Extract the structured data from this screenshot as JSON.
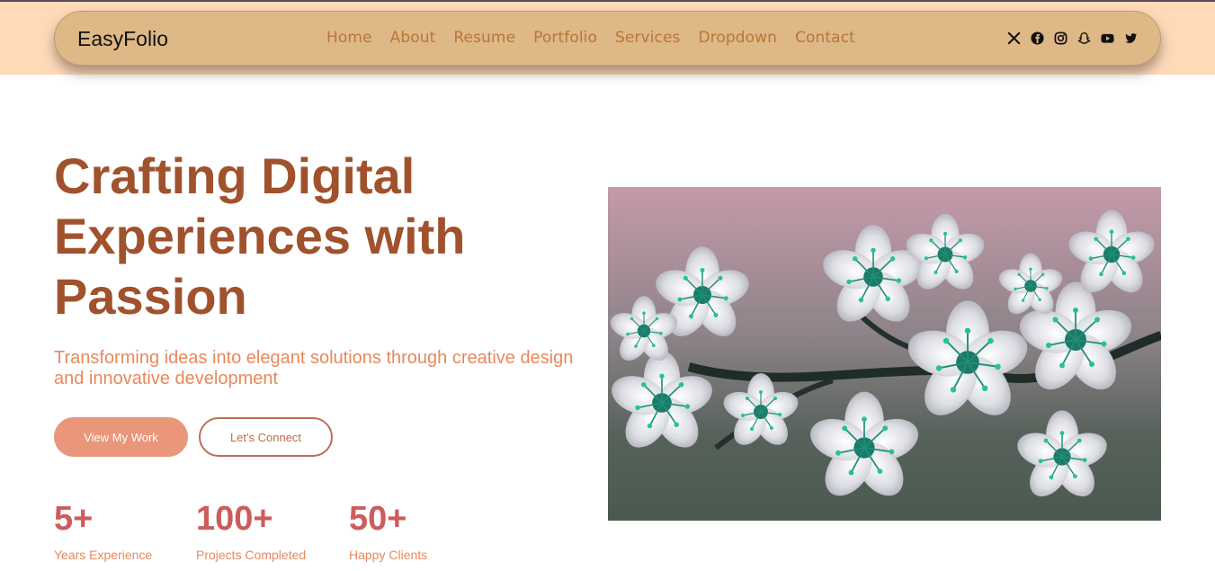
{
  "header": {
    "logo": "EasyFolio",
    "nav": [
      "Home",
      "About",
      "Resume",
      "Portfolio",
      "Services",
      "Dropdown",
      "Contact"
    ],
    "social_icons": [
      "x-icon",
      "facebook-icon",
      "instagram-icon",
      "snapchat-icon",
      "youtube-icon",
      "twitter-icon"
    ]
  },
  "hero": {
    "title": "Crafting Digital Experiences with Passion",
    "subtitle": "Transforming ideas into elegant solutions through creative design and innovative development",
    "primary_button": "View My Work",
    "secondary_button": "Let's Connect",
    "stats": [
      {
        "value": "5+",
        "label": "Years Experience"
      },
      {
        "value": "100+",
        "label": "Projects Completed"
      },
      {
        "value": "50+",
        "label": "Happy Clients"
      }
    ]
  },
  "colors": {
    "band": "#ffdab9",
    "navbar": "#deb887",
    "nav_link": "#b8763a",
    "title": "#a0522d",
    "subtitle": "#e8885c",
    "button": "#e9967a",
    "stat": "#cd5c5c"
  }
}
